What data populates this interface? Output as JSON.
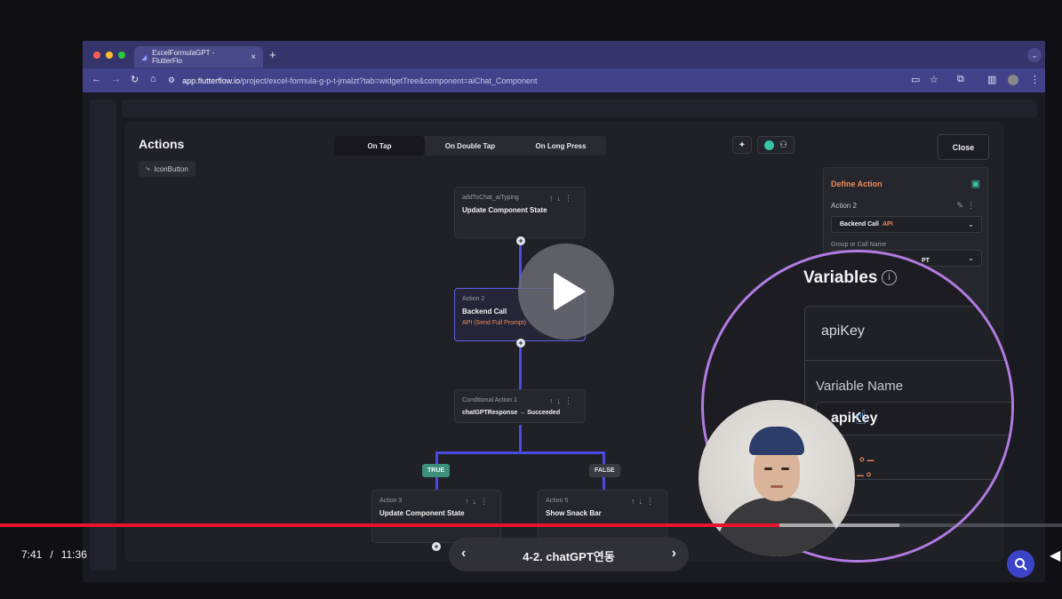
{
  "browser": {
    "tab_title": "ExcelFormulaGPT - FlutterFlo",
    "tab_close": "×",
    "new_tab": "+",
    "url_host": "app.flutterflow.io",
    "url_path": "/project/excel-formula-g-p-t-jmalzt?tab=widgetTree&component=aiChat_Component"
  },
  "modal": {
    "title": "Actions",
    "widget_chip": "IconButton",
    "tabs": [
      {
        "label": "On Tap",
        "active": true
      },
      {
        "label": "On Double Tap",
        "active": false
      },
      {
        "label": "On Long Press",
        "active": false
      }
    ],
    "close_label": "Close"
  },
  "flow": {
    "node1": {
      "sub": "addToChat_aiTyping",
      "main": "Update Component State"
    },
    "node2": {
      "sub": "Action 2",
      "main": "Backend Call",
      "extra": "API (Send Full Prompt)"
    },
    "node3": {
      "sub": "Conditional Action 1",
      "main": "chatGPTResponse → Succeeded"
    },
    "true_label": "TRUE",
    "false_label": "FALSE",
    "node4": {
      "sub": "Action 3",
      "main": "Update Component State"
    },
    "node5": {
      "sub": "Action 5",
      "main": "Show Snack Bar"
    }
  },
  "define_action": {
    "title": "Define Action",
    "action_label": "Action 2",
    "backend_call": "Backend Call",
    "api_tag": "API",
    "group_label": "Group or Call Name",
    "group_value_partial": "PT"
  },
  "zoom": {
    "variables_title": "Variables",
    "api_key": "apiKey",
    "variable_name_label": "Variable Name",
    "variable_value": "apiKey"
  },
  "player": {
    "current_time": "7:41",
    "separator": "/",
    "duration": "11:36",
    "chapter_title": "4-2. chatGPT연동",
    "progress_fraction": 0.734,
    "buffer_fraction": 0.847
  },
  "colors": {
    "accent": "#4b4be0",
    "orange": "#ef8a5a",
    "progress": "#e8132d",
    "zoom_ring": "#b27be0"
  }
}
